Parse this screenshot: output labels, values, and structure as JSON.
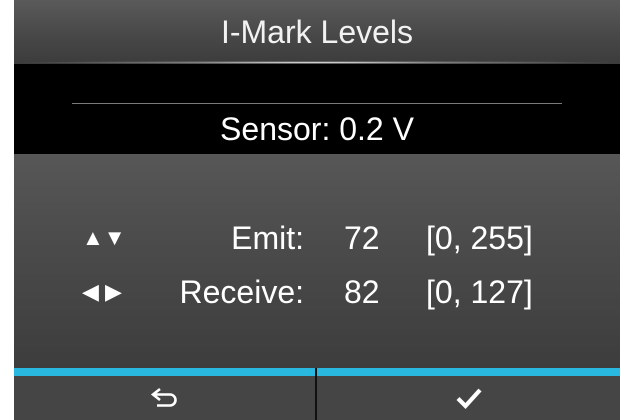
{
  "screen": {
    "title": "I-Mark Levels",
    "sensor": {
      "text": "Sensor: 0.2 V"
    },
    "rows": [
      {
        "arrows": "▲▼",
        "label": "Emit:",
        "value": "72",
        "range": "[0, 255]"
      },
      {
        "arrows": "◀ ▶",
        "label": "Receive:",
        "value": "82",
        "range": "[0, 127]"
      }
    ],
    "softkeys": {
      "back_icon": "return-arrow-icon",
      "ok_icon": "checkmark-icon"
    },
    "colors": {
      "accent": "#29b8e0",
      "background": "#4a4a4a",
      "band": "#000000",
      "text": "#ffffff"
    }
  }
}
